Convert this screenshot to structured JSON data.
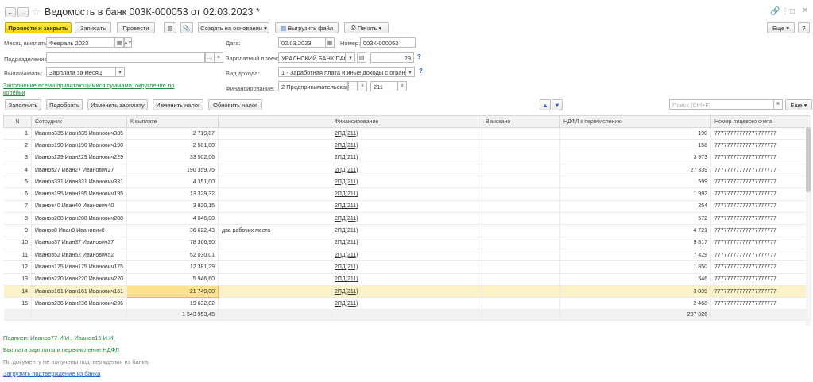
{
  "window": {
    "title": "Ведомость в банк 003К-000053 от 02.03.2023 *"
  },
  "toolbar": {
    "post_close": "Провести и закрыть",
    "save": "Записать",
    "post": "Провести",
    "create_based": "Создать на основании",
    "export_file": "Выгрузить файл",
    "print": "Печать",
    "more": "Еще"
  },
  "form": {
    "month_label": "Месяц выплаты:",
    "month_value": "Февраль 2023",
    "date_label": "Дата:",
    "date_value": "02.03.2023",
    "number_label": "Номер:",
    "number_value": "003К-000053",
    "division_label": "Подразделение:",
    "division_value": "",
    "salary_project_label": "Зарплатный проект:",
    "salary_project_value": "УРАЛЬСКИЙ БАНК ПАО",
    "salary_project_num": "29",
    "pay_label": "Выплачивать:",
    "pay_value": "Зарплата за месяц",
    "income_label": "Вид дохода:",
    "income_value": "1 - Заработная плата и иные доходы с ограничением взыскания",
    "funding_label": "Финансирование:",
    "funding_value": "2 Предпринимательская деятельность",
    "funding_code": "211",
    "fill_link": "Заполнение всеми причитающимися суммами, округление до копейки"
  },
  "table_toolbar": {
    "fill": "Заполнить",
    "select": "Подобрать",
    "change_salary": "Изменить зарплату",
    "change_tax": "Изменить налог",
    "update_tax": "Обновить налог",
    "search_placeholder": "Поиск (Ctrl+F)",
    "more": "Еще"
  },
  "columns": [
    "N",
    "Сотрудник",
    "К выплате",
    "",
    "Финансирование",
    "Взыскано",
    "НДФЛ к перечислению",
    "Номер лицевого счета"
  ],
  "rows": [
    {
      "n": "1",
      "emp": "Иванов335 Иван335 Иванович335",
      "pay": "2 719,87",
      "note": "",
      "fin": "2ПД(211)",
      "coll": "",
      "ndfl": "190",
      "acc": "77777777777777777777"
    },
    {
      "n": "2",
      "emp": "Иванов190 Иван190 Иванович190",
      "pay": "2 501,00",
      "note": "",
      "fin": "2ПД(211)",
      "coll": "",
      "ndfl": "158",
      "acc": "77777777777777777777"
    },
    {
      "n": "3",
      "emp": "Иванов229 Иван229 Иванович229",
      "pay": "33 502,06",
      "note": "",
      "fin": "2ПД(211)",
      "coll": "",
      "ndfl": "3 973",
      "acc": "77777777777777777777"
    },
    {
      "n": "4",
      "emp": "Иванов27 Иван27 Иванович27",
      "pay": "190 359,75",
      "note": "",
      "fin": "2ПД(211)",
      "coll": "",
      "ndfl": "27 339",
      "acc": "77777777777777777777"
    },
    {
      "n": "5",
      "emp": "Иванов331 Иван331 Иванович331",
      "pay": "4 351,00",
      "note": "",
      "fin": "2ПД(211)",
      "coll": "",
      "ndfl": "599",
      "acc": "77777777777777777777"
    },
    {
      "n": "6",
      "emp": "Иванов195 Иван195 Иванович195",
      "pay": "13 329,32",
      "note": "",
      "fin": "2ПД(211)",
      "coll": "",
      "ndfl": "1 992",
      "acc": "77777777777777777777"
    },
    {
      "n": "7",
      "emp": "Иванов40 Иван40 Иванович40",
      "pay": "3 820,15",
      "note": "",
      "fin": "2ПД(211)",
      "coll": "",
      "ndfl": "254",
      "acc": "77777777777777777777"
    },
    {
      "n": "8",
      "emp": "Иванов288 Иван288 Иванович288",
      "pay": "4 046,00",
      "note": "",
      "fin": "2ПД(211)",
      "coll": "",
      "ndfl": "572",
      "acc": "77777777777777777777"
    },
    {
      "n": "9",
      "emp": "Иванов8 Иван8 Иванович8",
      "pay": "36 622,43",
      "note": "два рабочих места",
      "fin": "2ПД(211)",
      "coll": "",
      "ndfl": "4 721",
      "acc": "77777777777777777777"
    },
    {
      "n": "10",
      "emp": "Иванов37 Иван37 Иванович37",
      "pay": "78 366,90",
      "note": "",
      "fin": "2ПД(211)",
      "coll": "",
      "ndfl": "9 817",
      "acc": "77777777777777777777"
    },
    {
      "n": "11",
      "emp": "Иванов52 Иван52 Иванович52",
      "pay": "52 030,01",
      "note": "",
      "fin": "2ПД(211)",
      "coll": "",
      "ndfl": "7 429",
      "acc": "77777777777777777777"
    },
    {
      "n": "12",
      "emp": "Иванов175 Иван175 Иванович175",
      "pay": "12 381,29",
      "note": "",
      "fin": "2ПД(211)",
      "coll": "",
      "ndfl": "1 850",
      "acc": "77777777777777777777"
    },
    {
      "n": "13",
      "emp": "Иванов220 Иван220 Иванович220",
      "pay": "5 946,60",
      "note": "",
      "fin": "2ПД(211)",
      "coll": "",
      "ndfl": "546",
      "acc": "77777777777777777777"
    },
    {
      "n": "14",
      "emp": "Иванов161 Иван161 Иванович161",
      "pay": "21 749,00",
      "note": "",
      "fin": "2ПД(211)",
      "coll": "",
      "ndfl": "3 039",
      "acc": "77777777777777777777"
    },
    {
      "n": "15",
      "emp": "Иванов236 Иван236 Иванович236",
      "pay": "19 632,82",
      "note": "",
      "fin": "2ПД(211)",
      "coll": "",
      "ndfl": "2 468",
      "acc": "77777777777777777777"
    }
  ],
  "selected_row": "14",
  "totals": {
    "pay": "1 543 953,45",
    "ndfl": "207 826"
  },
  "footer": {
    "signatures": "Подписи: Иванов77 И.И., Иванов15 И.И.",
    "payment_link": "Выплата зарплаты и перечисление НДФЛ",
    "no_confirm": "По документу не получены подтверждения из банка",
    "load_confirm": "Загрузить подтверждение из банка"
  },
  "colors": {
    "primary": "#f7d308",
    "link": "#1e8c3a",
    "selected_row": "#fcf1c7"
  }
}
